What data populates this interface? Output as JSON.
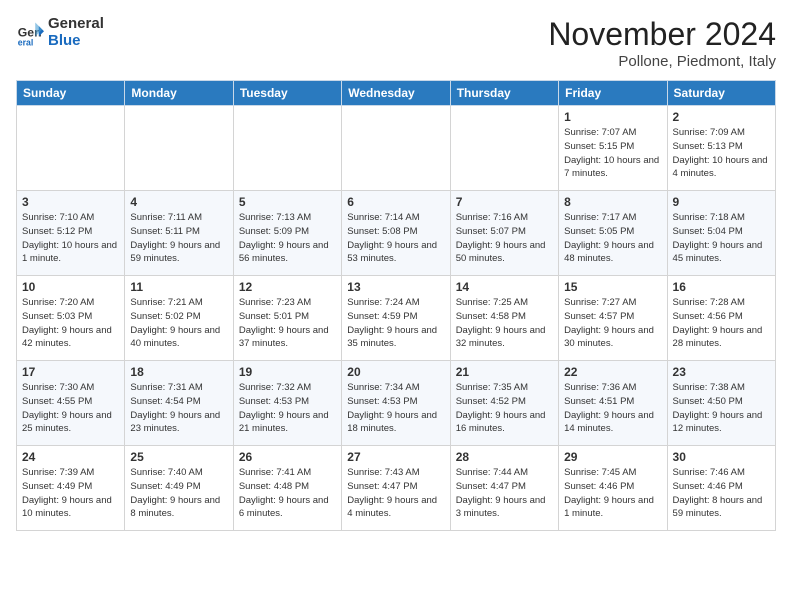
{
  "logo": {
    "general": "General",
    "blue": "Blue"
  },
  "title": "November 2024",
  "location": "Pollone, Piedmont, Italy",
  "headers": [
    "Sunday",
    "Monday",
    "Tuesday",
    "Wednesday",
    "Thursday",
    "Friday",
    "Saturday"
  ],
  "weeks": [
    [
      {
        "day": "",
        "info": ""
      },
      {
        "day": "",
        "info": ""
      },
      {
        "day": "",
        "info": ""
      },
      {
        "day": "",
        "info": ""
      },
      {
        "day": "",
        "info": ""
      },
      {
        "day": "1",
        "info": "Sunrise: 7:07 AM\nSunset: 5:15 PM\nDaylight: 10 hours and 7 minutes."
      },
      {
        "day": "2",
        "info": "Sunrise: 7:09 AM\nSunset: 5:13 PM\nDaylight: 10 hours and 4 minutes."
      }
    ],
    [
      {
        "day": "3",
        "info": "Sunrise: 7:10 AM\nSunset: 5:12 PM\nDaylight: 10 hours and 1 minute."
      },
      {
        "day": "4",
        "info": "Sunrise: 7:11 AM\nSunset: 5:11 PM\nDaylight: 9 hours and 59 minutes."
      },
      {
        "day": "5",
        "info": "Sunrise: 7:13 AM\nSunset: 5:09 PM\nDaylight: 9 hours and 56 minutes."
      },
      {
        "day": "6",
        "info": "Sunrise: 7:14 AM\nSunset: 5:08 PM\nDaylight: 9 hours and 53 minutes."
      },
      {
        "day": "7",
        "info": "Sunrise: 7:16 AM\nSunset: 5:07 PM\nDaylight: 9 hours and 50 minutes."
      },
      {
        "day": "8",
        "info": "Sunrise: 7:17 AM\nSunset: 5:05 PM\nDaylight: 9 hours and 48 minutes."
      },
      {
        "day": "9",
        "info": "Sunrise: 7:18 AM\nSunset: 5:04 PM\nDaylight: 9 hours and 45 minutes."
      }
    ],
    [
      {
        "day": "10",
        "info": "Sunrise: 7:20 AM\nSunset: 5:03 PM\nDaylight: 9 hours and 42 minutes."
      },
      {
        "day": "11",
        "info": "Sunrise: 7:21 AM\nSunset: 5:02 PM\nDaylight: 9 hours and 40 minutes."
      },
      {
        "day": "12",
        "info": "Sunrise: 7:23 AM\nSunset: 5:01 PM\nDaylight: 9 hours and 37 minutes."
      },
      {
        "day": "13",
        "info": "Sunrise: 7:24 AM\nSunset: 4:59 PM\nDaylight: 9 hours and 35 minutes."
      },
      {
        "day": "14",
        "info": "Sunrise: 7:25 AM\nSunset: 4:58 PM\nDaylight: 9 hours and 32 minutes."
      },
      {
        "day": "15",
        "info": "Sunrise: 7:27 AM\nSunset: 4:57 PM\nDaylight: 9 hours and 30 minutes."
      },
      {
        "day": "16",
        "info": "Sunrise: 7:28 AM\nSunset: 4:56 PM\nDaylight: 9 hours and 28 minutes."
      }
    ],
    [
      {
        "day": "17",
        "info": "Sunrise: 7:30 AM\nSunset: 4:55 PM\nDaylight: 9 hours and 25 minutes."
      },
      {
        "day": "18",
        "info": "Sunrise: 7:31 AM\nSunset: 4:54 PM\nDaylight: 9 hours and 23 minutes."
      },
      {
        "day": "19",
        "info": "Sunrise: 7:32 AM\nSunset: 4:53 PM\nDaylight: 9 hours and 21 minutes."
      },
      {
        "day": "20",
        "info": "Sunrise: 7:34 AM\nSunset: 4:53 PM\nDaylight: 9 hours and 18 minutes."
      },
      {
        "day": "21",
        "info": "Sunrise: 7:35 AM\nSunset: 4:52 PM\nDaylight: 9 hours and 16 minutes."
      },
      {
        "day": "22",
        "info": "Sunrise: 7:36 AM\nSunset: 4:51 PM\nDaylight: 9 hours and 14 minutes."
      },
      {
        "day": "23",
        "info": "Sunrise: 7:38 AM\nSunset: 4:50 PM\nDaylight: 9 hours and 12 minutes."
      }
    ],
    [
      {
        "day": "24",
        "info": "Sunrise: 7:39 AM\nSunset: 4:49 PM\nDaylight: 9 hours and 10 minutes."
      },
      {
        "day": "25",
        "info": "Sunrise: 7:40 AM\nSunset: 4:49 PM\nDaylight: 9 hours and 8 minutes."
      },
      {
        "day": "26",
        "info": "Sunrise: 7:41 AM\nSunset: 4:48 PM\nDaylight: 9 hours and 6 minutes."
      },
      {
        "day": "27",
        "info": "Sunrise: 7:43 AM\nSunset: 4:47 PM\nDaylight: 9 hours and 4 minutes."
      },
      {
        "day": "28",
        "info": "Sunrise: 7:44 AM\nSunset: 4:47 PM\nDaylight: 9 hours and 3 minutes."
      },
      {
        "day": "29",
        "info": "Sunrise: 7:45 AM\nSunset: 4:46 PM\nDaylight: 9 hours and 1 minute."
      },
      {
        "day": "30",
        "info": "Sunrise: 7:46 AM\nSunset: 4:46 PM\nDaylight: 8 hours and 59 minutes."
      }
    ]
  ]
}
